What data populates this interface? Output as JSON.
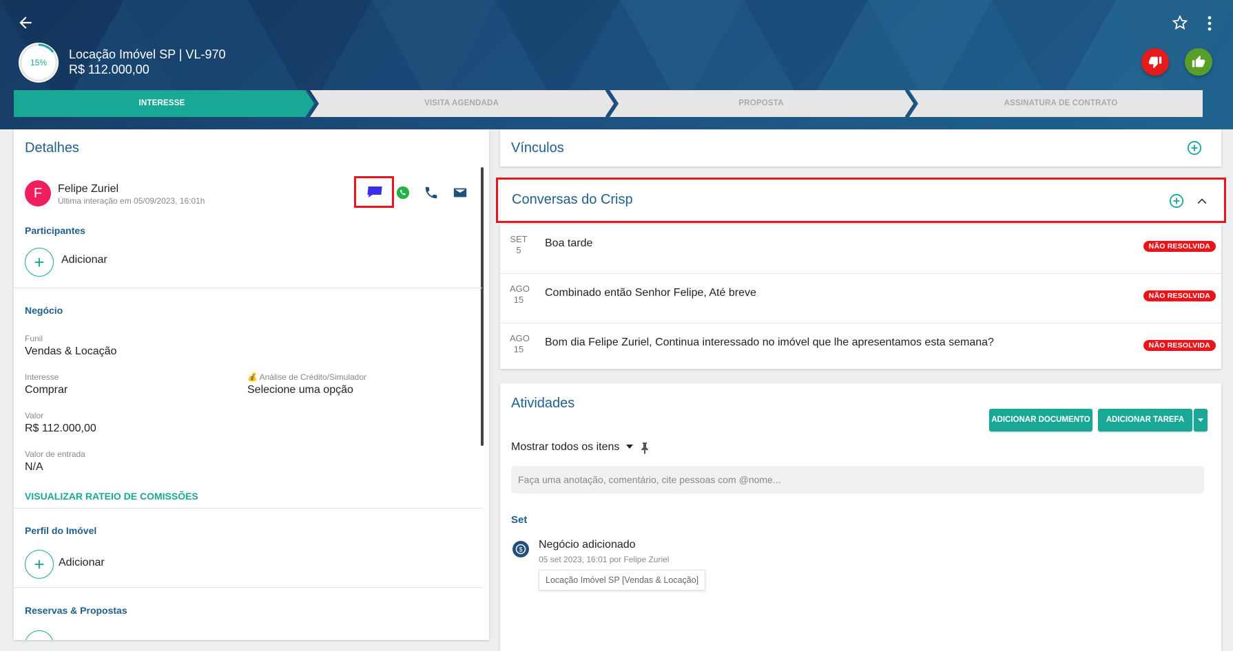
{
  "header": {
    "progress": "15%",
    "progress_value": 0.15,
    "deal_title": "Locação Imóvel SP | VL-970",
    "deal_value": "R$ 112.000,00"
  },
  "stages": [
    {
      "label": "INTERESSE",
      "active": true
    },
    {
      "label": "VISITA AGENDADA",
      "active": false
    },
    {
      "label": "PROPOSTA",
      "active": false
    },
    {
      "label": "ASSINATURA DE CONTRATO",
      "active": false
    }
  ],
  "details": {
    "title": "Detalhes",
    "contact": {
      "initial": "F",
      "name": "Felipe Zuriel",
      "last_interaction": "Última interação em 05/09/2023, 16:01h"
    },
    "participants_title": "Participantes",
    "add_label": "Adicionar",
    "business_title": "Negócio",
    "funnel_label": "Funil",
    "funnel_value": "Vendas & Locação",
    "interest_label": "Interesse",
    "interest_value": "Comprar",
    "credit_label": "💰 Análise de Crédito/Simulador",
    "credit_value": "Selecione uma opção",
    "value_label": "Valor",
    "value_value": "R$ 112.000,00",
    "entry_label": "Valor de entrada",
    "entry_value": "N/A",
    "commission_link": "VISUALIZAR RATEIO DE COMISSÕES",
    "property_profile_title": "Perfil do Imóvel",
    "property_add_label": "Adicionar",
    "reservations_title": "Reservas & Propostas"
  },
  "vinculos": {
    "title": "Vínculos"
  },
  "crisp": {
    "title": "Conversas do Crisp",
    "conversations": [
      {
        "month": "SET",
        "day": "5",
        "text": "Boa tarde",
        "status": "NÃO RESOLVIDA"
      },
      {
        "month": "AGO",
        "day": "15",
        "text": "Combinado então Senhor Felipe, Até breve",
        "status": "NÃO RESOLVIDA"
      },
      {
        "month": "AGO",
        "day": "15",
        "text": "Bom dia Felipe Zuriel, Continua interessado no imóvel que lhe apresentamos esta semana?",
        "status": "NÃO RESOLVIDA"
      }
    ]
  },
  "activities": {
    "title": "Atividades",
    "add_document": "ADICIONAR DOCUMENTO",
    "add_task": "ADICIONAR TAREFA",
    "filter": "Mostrar todos os itens",
    "note_placeholder": "Faça uma anotação, comentário, cite pessoas com @nome...",
    "month_group": "Set",
    "item_title": "Negócio adicionado",
    "item_meta": "05 set 2023, 16:01 por Felipe Zuriel",
    "item_tag": "Locação Imóvel SP [Vendas & Locação]"
  },
  "colors": {
    "teal": "#1aa896",
    "blue_title": "#1f5f8b",
    "red": "#e8151b",
    "green_like": "#5a9e2a",
    "avatar": "#ee1f5c"
  }
}
